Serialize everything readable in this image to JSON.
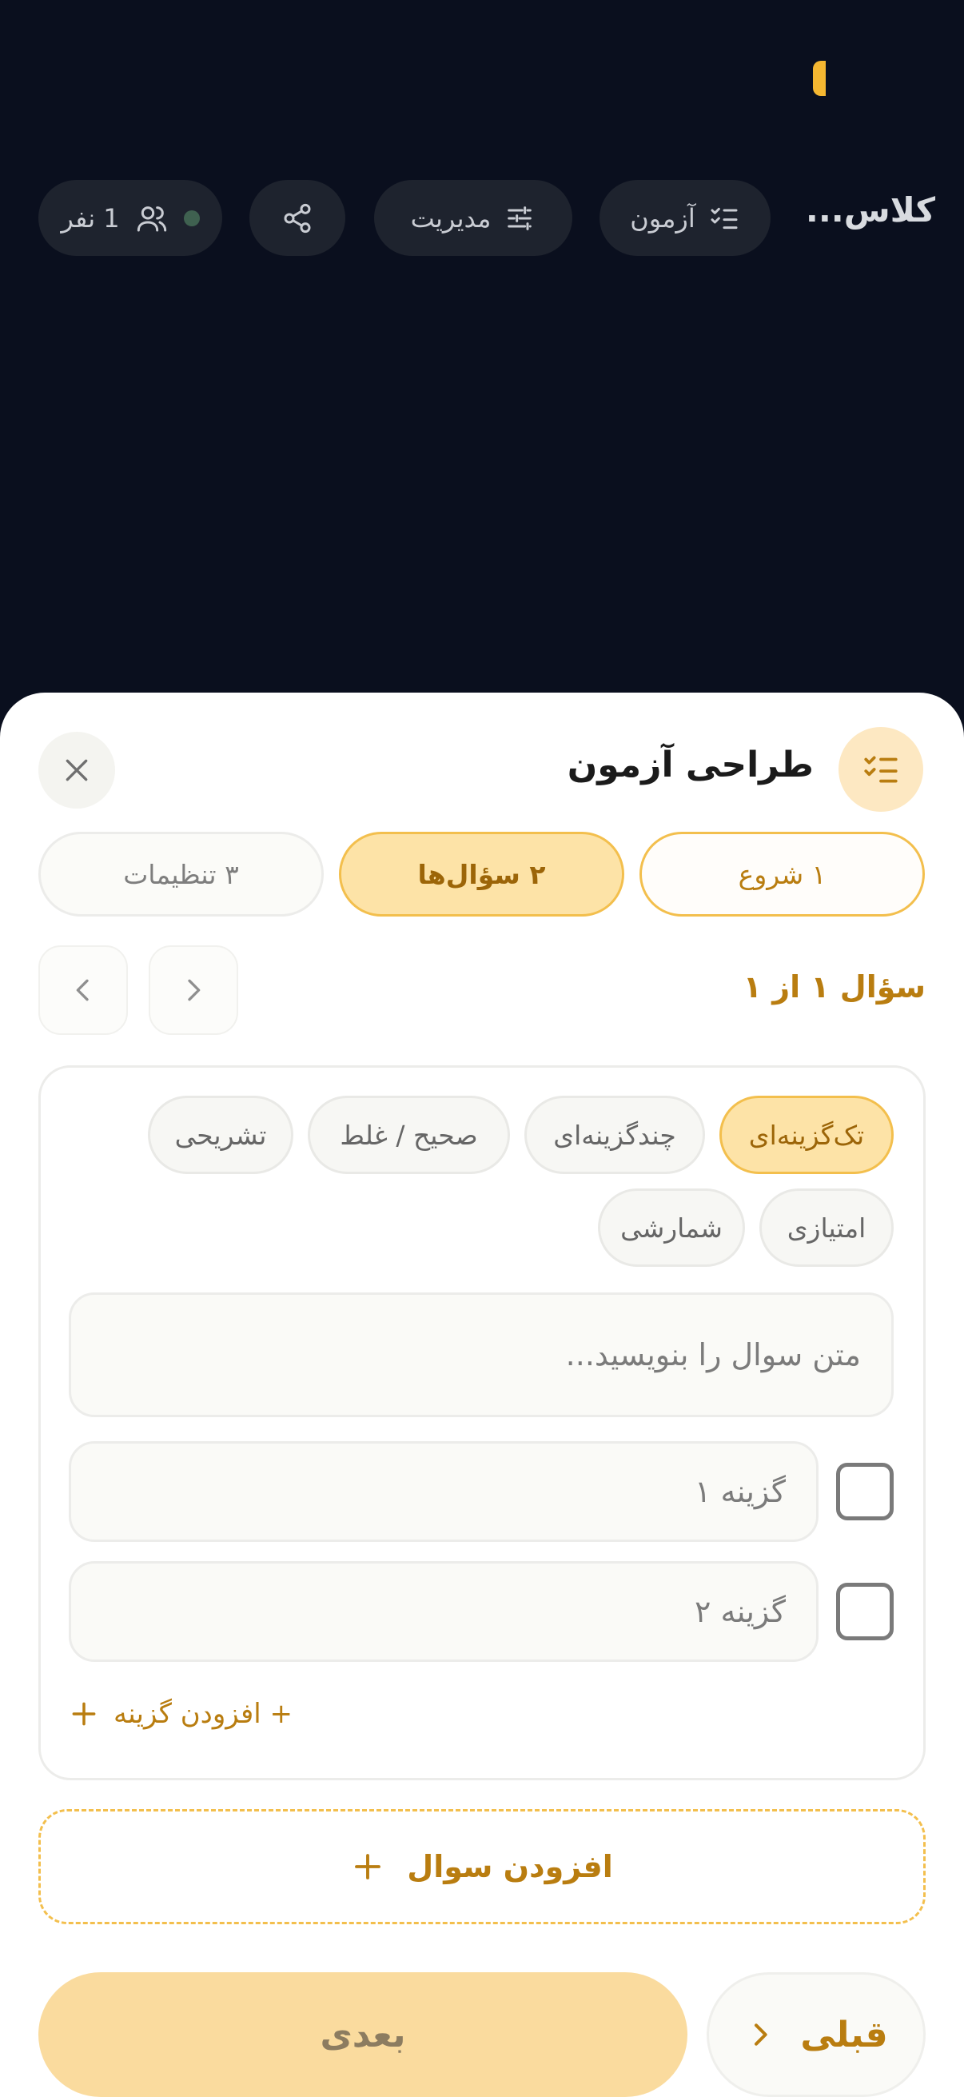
{
  "header": {
    "class_title": "کلاس...",
    "exam_label": "آزمون",
    "manage_label": "مدیریت",
    "members_label": "1 نفر"
  },
  "sheet": {
    "title": "طراحی آزمون",
    "steps": [
      {
        "label": "۱ شروع"
      },
      {
        "label": "۲ سؤال‌ها"
      },
      {
        "label": "۳ تنظیمات"
      }
    ],
    "question_counter": "سؤال ۱ از ۱",
    "question_types": [
      {
        "label": "تک‌گزینه‌ای",
        "active": true
      },
      {
        "label": "چندگزینه‌ای"
      },
      {
        "label": "صحیح / غلط"
      },
      {
        "label": "تشریحی"
      },
      {
        "label": "امتیازی"
      },
      {
        "label": "شمارشی"
      }
    ],
    "question_placeholder": "متن سوال را بنویسید...",
    "options": [
      {
        "placeholder": "گزینه ۱",
        "checked": false
      },
      {
        "placeholder": "گزینه ۲",
        "checked": false
      }
    ],
    "add_option_label": "+ افزودن گزینه",
    "add_question_label": "افزودن سوال",
    "next_label": "بعدی",
    "prev_label": "قبلی"
  },
  "colors": {
    "accent": "#b97d10",
    "accent_bg": "#fde3a7",
    "dark_bg": "#0a0f1e"
  },
  "icons": [
    "checklist-icon",
    "sliders-icon",
    "share-icon",
    "users-icon",
    "close-icon",
    "chevron-left-icon",
    "chevron-right-icon",
    "plus-icon"
  ]
}
